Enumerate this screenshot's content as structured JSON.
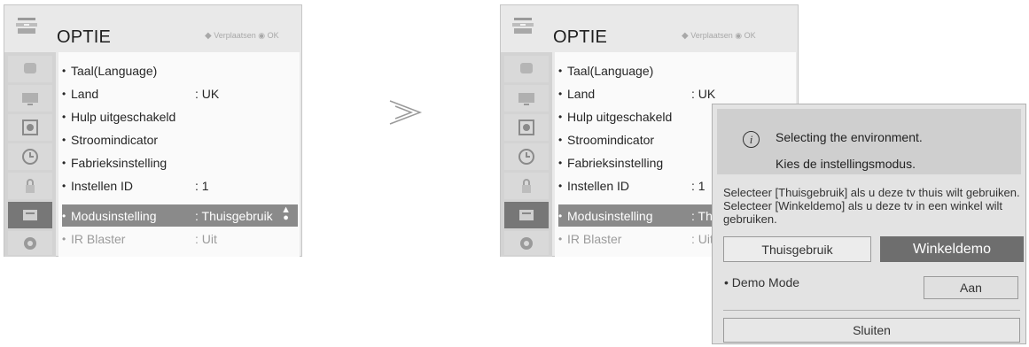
{
  "left_panel": {
    "title": "OPTIE",
    "nav_hint": "Verplaatsen",
    "ok_hint": "OK",
    "items": [
      {
        "label": "Taal(Language)",
        "value": ""
      },
      {
        "label": "Land",
        "value": ": UK"
      },
      {
        "label": "Hulp uitgeschakeld",
        "value": ""
      },
      {
        "label": "Stroomindicator",
        "value": ""
      },
      {
        "label": "Fabrieksinstelling",
        "value": ""
      },
      {
        "label": "Instellen ID",
        "value": ": 1"
      },
      {
        "label": "Modusinstelling",
        "value": ": Thuisgebruik"
      },
      {
        "label": "IR Blaster",
        "value": ": Uit"
      }
    ]
  },
  "right_panel": {
    "title": "OPTIE",
    "nav_hint": "Verplaatsen",
    "ok_hint": "OK",
    "items": [
      {
        "label": "Taal(Language)",
        "value": ""
      },
      {
        "label": "Land",
        "value": ": UK"
      },
      {
        "label": "Hulp uitgeschakeld",
        "value": ""
      },
      {
        "label": "Stroomindicator",
        "value": ""
      },
      {
        "label": "Fabrieksinstelling",
        "value": ""
      },
      {
        "label": "Instellen ID",
        "value": ": 1"
      },
      {
        "label": "Modusinstelling",
        "value": ": Thu"
      },
      {
        "label": "IR Blaster",
        "value": ": Uit"
      }
    ]
  },
  "side_icons": [
    "tv-icon",
    "screen-icon",
    "speaker-icon",
    "clock-icon",
    "lock-icon",
    "option-icon",
    "network-icon"
  ],
  "selected_item_index": 6,
  "separator_icon": "chevron-right-icon",
  "dialog": {
    "line1": "Selecting the environment.",
    "line2": "Kies de instellingsmodus.",
    "description": "Selecteer [Thuisgebruik] als u deze tv thuis wilt gebruiken. Selecteer [Winkeldemo] als u deze tv in een winkel wilt gebruiken.",
    "home_button": "Thuisgebruik",
    "store_button": "Winkeldemo",
    "demo_label": "• Demo Mode",
    "demo_value": "Aan",
    "close_button": "Sluiten"
  },
  "colors": {
    "panel_bg": "#e9e9e9",
    "list_bg": "#fafafa",
    "selected_row": "#8a8a8a",
    "dialog_bg": "#e3e3e3",
    "store_button_bg": "#6e6e6e"
  }
}
